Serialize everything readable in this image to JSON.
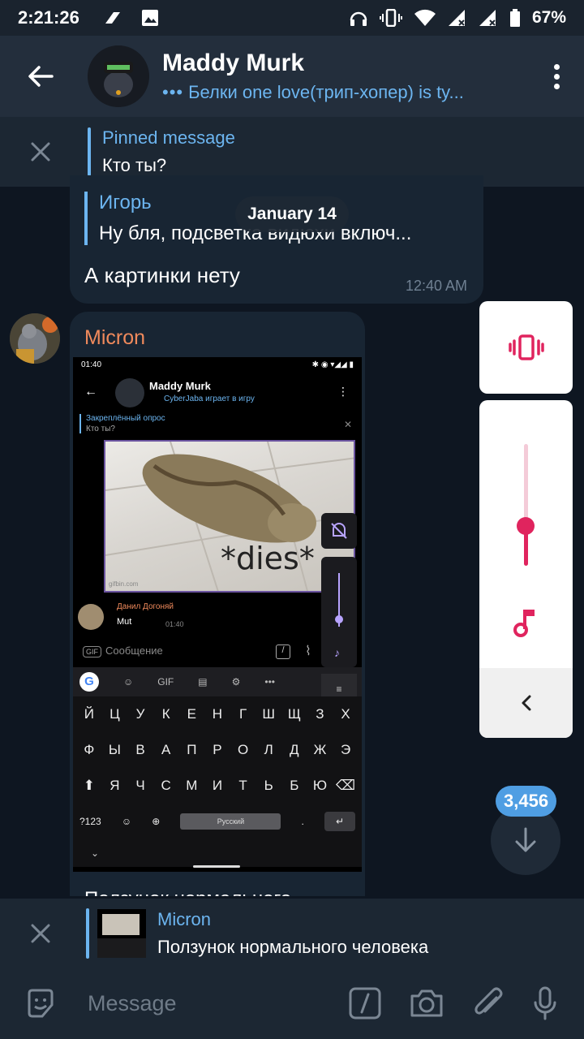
{
  "status_bar": {
    "time": "2:21:26",
    "battery": "67%"
  },
  "header": {
    "title": "Maddy Murk",
    "typing": "Белки one love(трип-хопер) is ty..."
  },
  "pinned": {
    "title": "Pinned message",
    "text": "Кто ты?"
  },
  "date_chip": "January 14",
  "message1": {
    "reply_name": "Игорь",
    "reply_text": "Ну бля, подсветка видюхи включ...",
    "text": "А картинки нету",
    "time": "12:40 AM"
  },
  "message2": {
    "sender": "Micron",
    "caption": "Ползунок нормального человека",
    "screenshot": {
      "time": "01:40",
      "chat_title": "Maddy Murk",
      "chat_status": "CyberJaba играет в игру",
      "pinned_title": "Закреплённый опрос",
      "pinned_text": "Кто ты?",
      "gif_text": "*dies*",
      "gif_watermark": "gifbin.com",
      "msg_name": "Данил Догоняй",
      "msg_text": "Mut",
      "msg_time": "01:40",
      "input_placeholder": "Сообщение",
      "kb_row1": [
        "Й",
        "Ц",
        "У",
        "К",
        "Е",
        "Н",
        "Г",
        "Ш",
        "Щ",
        "З",
        "Х"
      ],
      "kb_row2": [
        "Ф",
        "Ы",
        "В",
        "А",
        "П",
        "Р",
        "О",
        "Л",
        "Д",
        "Ж",
        "Э"
      ],
      "kb_row3": [
        "⬆",
        "Я",
        "Ч",
        "С",
        "М",
        "И",
        "Т",
        "Ь",
        "Б",
        "Ю",
        "⌫"
      ],
      "kb_sym": "?123",
      "kb_space": "Русский",
      "kb_dot": "."
    }
  },
  "volume_panel": {
    "accent": "#e0245e",
    "level": 0.37
  },
  "unread_counter": "3,456",
  "reply_bar": {
    "name": "Micron",
    "text": "Ползунок нормального человека"
  },
  "composer": {
    "placeholder": "Message"
  }
}
